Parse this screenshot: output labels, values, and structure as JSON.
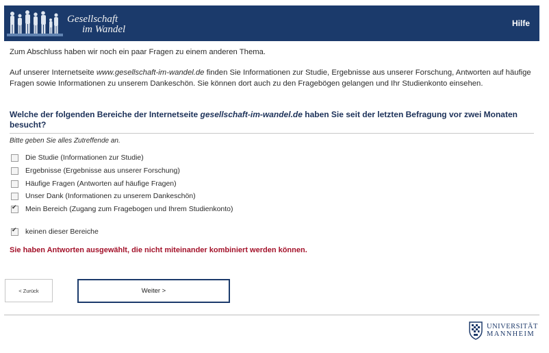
{
  "header": {
    "logo_line1": "Gesellschaft",
    "logo_line2": "im Wandel",
    "help_label": "Hilfe"
  },
  "intro": {
    "line1": "Zum Abschluss haben wir noch ein paar Fragen zu einem anderen Thema.",
    "p2_before": "Auf unserer Internetseite ",
    "p2_url": "www.gesellschaft-im-wandel.de",
    "p2_after": " finden Sie Informationen zur Studie, Ergebnisse aus unserer Forschung, Antworten auf häufige Fragen sowie Informationen zu unserem Dankeschön. Sie können dort auch zu den Fragebögen gelangen und Ihr Studienkonto einsehen."
  },
  "question": {
    "before": "Welche der folgenden Bereiche der Internetseite ",
    "site": "gesellschaft-im-wandel.de",
    "after": " haben Sie seit der letzten Befragung vor zwei Monaten besucht?",
    "hint": "Bitte geben Sie alles Zutreffende an."
  },
  "options": [
    {
      "label": "Die Studie (Informationen zur Studie)",
      "checked": false
    },
    {
      "label": "Ergebnisse (Ergebnisse aus unserer Forschung)",
      "checked": false
    },
    {
      "label": "Häufige Fragen (Antworten auf häufige Fragen)",
      "checked": false
    },
    {
      "label": "Unser Dank (Informationen zu unserem Dankeschön)",
      "checked": false
    },
    {
      "label": "Mein Bereich (Zugang zum Fragebogen und Ihrem Studienkonto)",
      "checked": true
    },
    {
      "label": "keinen dieser Bereiche",
      "checked": true
    }
  ],
  "error": "Sie haben Antworten ausgewählt, die nicht miteinander kombiniert werden können.",
  "nav": {
    "back_label": "< Zurück",
    "next_label": "Weiter >"
  },
  "footer": {
    "uni_line1": "UNIVERSITÄT",
    "uni_line2": "MANNHEIM"
  },
  "colors": {
    "header_bg": "#1b3a6b",
    "error": "#a3122a",
    "question": "#1b3058"
  }
}
